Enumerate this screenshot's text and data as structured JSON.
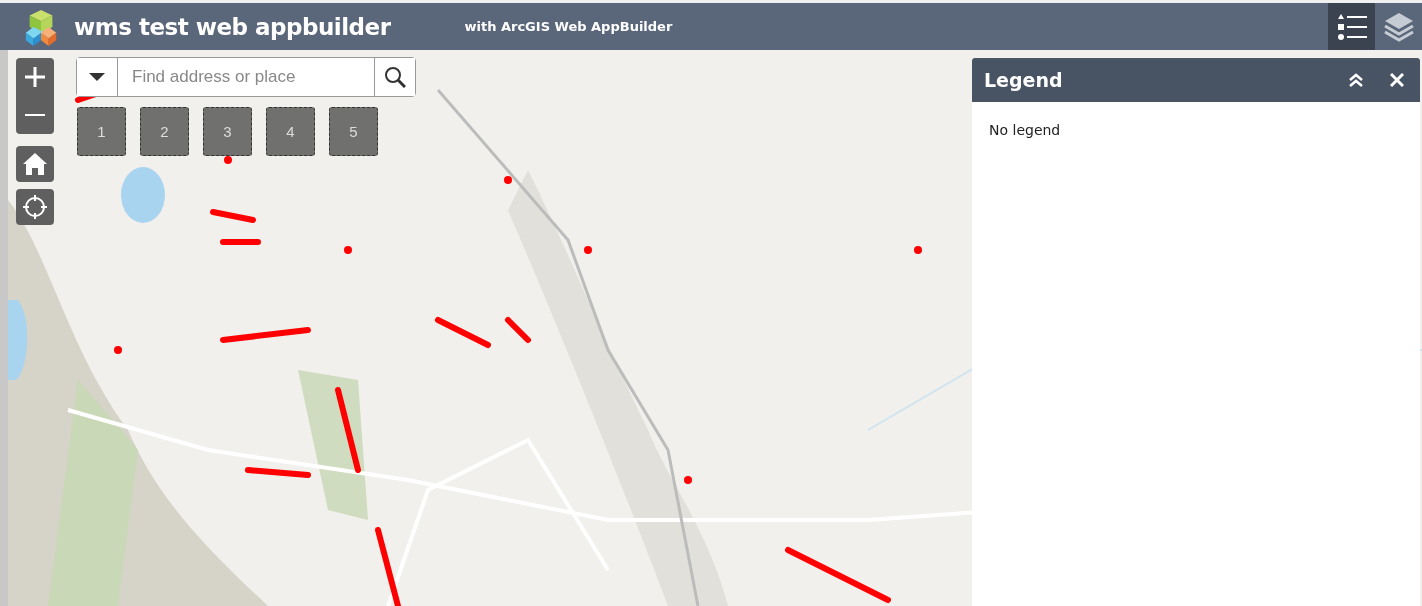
{
  "header": {
    "title": "wms test web appbuilder",
    "subtitle": "with ArcGIS Web AppBuilder",
    "buttons": [
      {
        "kind": "legend",
        "selected": true
      },
      {
        "kind": "layers",
        "selected": false
      }
    ]
  },
  "map": {
    "kind": "picture",
    "search": {
      "placeholder": "Find address or place"
    },
    "bookmarks": [
      "1",
      "2",
      "3",
      "4",
      "5"
    ]
  },
  "legend_panel": {
    "title": "Legend",
    "message": "No legend"
  }
}
